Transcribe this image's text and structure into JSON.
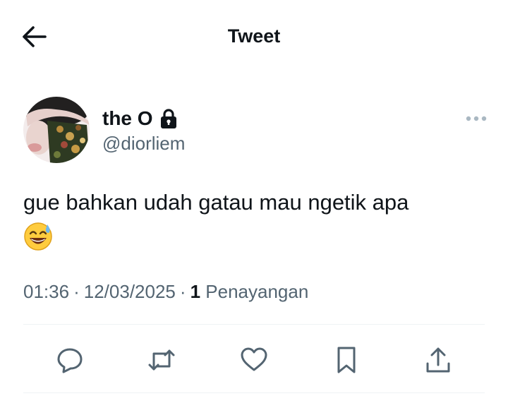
{
  "header": {
    "title": "Tweet",
    "back_icon": "arrow-left-icon"
  },
  "author": {
    "display_name": "the O",
    "handle": "@diorliem",
    "protected_icon": "lock-icon",
    "avatar_icon": "avatar"
  },
  "tweet": {
    "text": "gue bahkan udah gatau mau ngetik apa",
    "emoji": "😅"
  },
  "meta": {
    "time": "01:36",
    "separator": "·",
    "date": "12/03/2025",
    "views_count": "1",
    "views_label": "Penayangan"
  },
  "actions": [
    {
      "name": "reply",
      "icon": "reply-icon"
    },
    {
      "name": "retweet",
      "icon": "retweet-icon"
    },
    {
      "name": "like",
      "icon": "heart-icon"
    },
    {
      "name": "bookmark",
      "icon": "bookmark-icon"
    },
    {
      "name": "share",
      "icon": "share-icon"
    }
  ],
  "colors": {
    "text": "#0f1419",
    "secondary": "#536471",
    "divider": "#eff3f4",
    "background": "#ffffff"
  }
}
